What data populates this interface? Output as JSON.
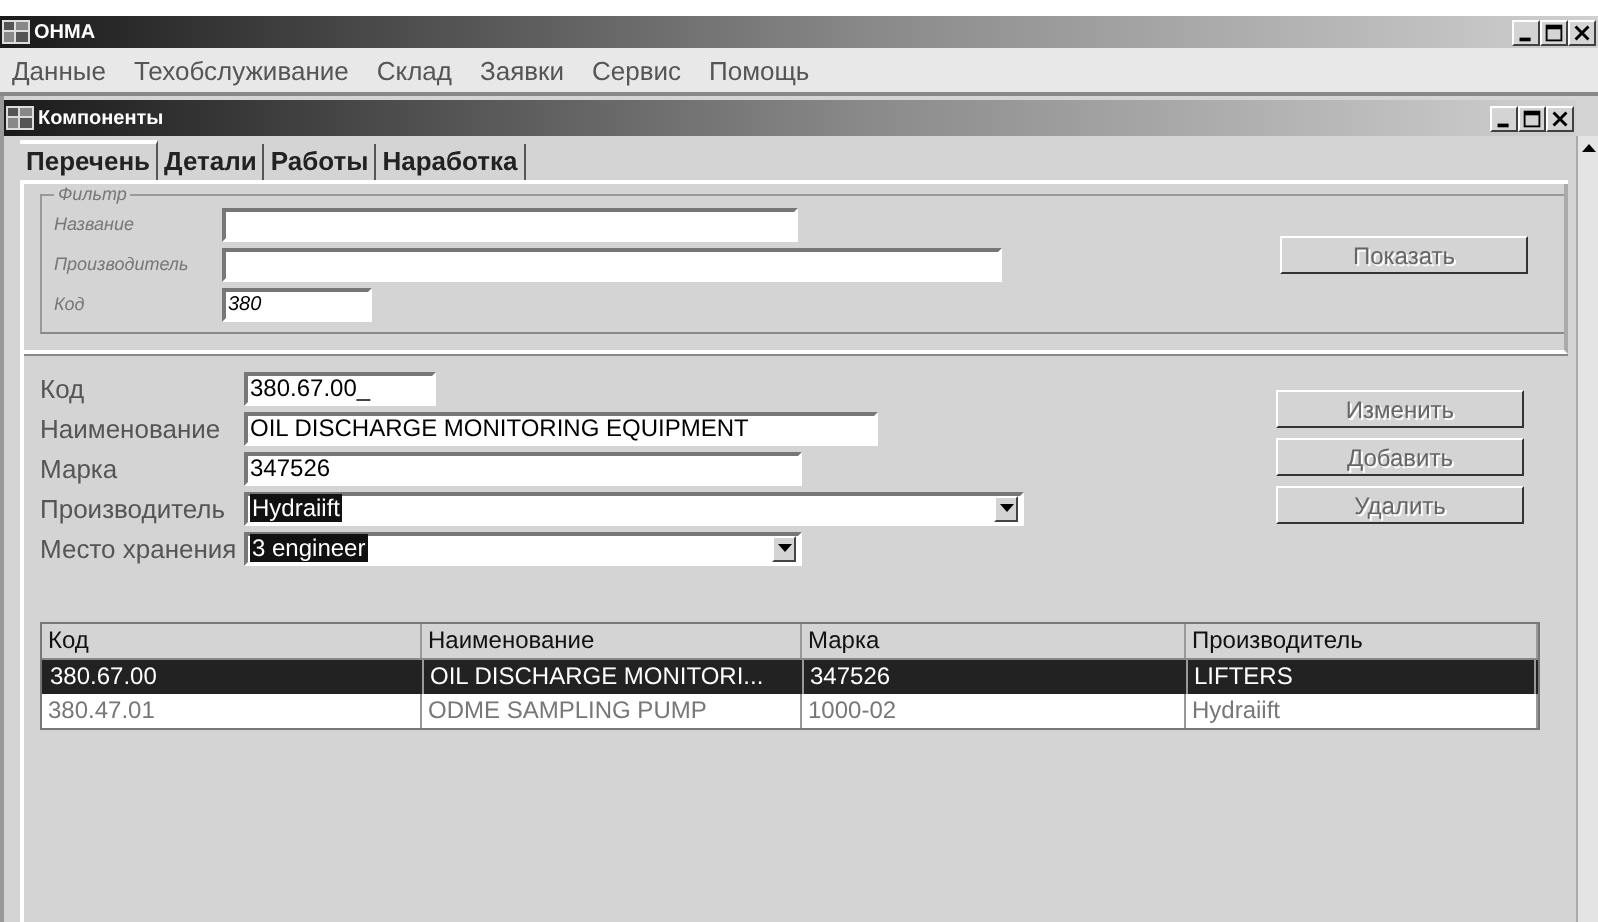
{
  "window": {
    "title": "OHMA"
  },
  "menu": [
    "Данные",
    "Техобслуживание",
    "Склад",
    "Заявки",
    "Сервис",
    "Помощь"
  ],
  "child_window": {
    "title": "Компоненты"
  },
  "tabs": [
    {
      "label": "Перечень",
      "selected": true
    },
    {
      "label": "Детали",
      "selected": false
    },
    {
      "label": "Работы",
      "selected": false
    },
    {
      "label": "Наработка",
      "selected": false
    }
  ],
  "filter": {
    "title": "Фильтр",
    "fields": [
      {
        "label": "Название"
      },
      {
        "label": "Производитель"
      },
      {
        "label": "Код",
        "value": "380"
      }
    ],
    "button": "Показать"
  },
  "details": {
    "fields": [
      {
        "label": "Код",
        "value": "380.67.00_",
        "kind": "text"
      },
      {
        "label": "Наименование",
        "value": "OIL DISCHARGE MONITORING EQUIPMENT",
        "kind": "text"
      },
      {
        "label": "Марка",
        "value": "347526",
        "kind": "text"
      },
      {
        "label": "Производитель",
        "value": "Hydraiift",
        "kind": "combo"
      },
      {
        "label": "Место хранения",
        "value": "3 engineer",
        "kind": "combo"
      }
    ],
    "buttons": [
      "Изменить",
      "Добавить",
      "Удалить"
    ]
  },
  "table": {
    "columns": [
      "Код",
      "Наименование",
      "Марка",
      "Производитель"
    ],
    "rows": [
      {
        "cells": [
          "380.67.00",
          "OIL DISCHARGE MONITORI...",
          "347526",
          "LIFTERS"
        ],
        "selected": true
      },
      {
        "cells": [
          "380.47.01",
          "ODME SAMPLING PUMP",
          "1000-02",
          "Hydraiift"
        ],
        "selected": false
      }
    ]
  }
}
